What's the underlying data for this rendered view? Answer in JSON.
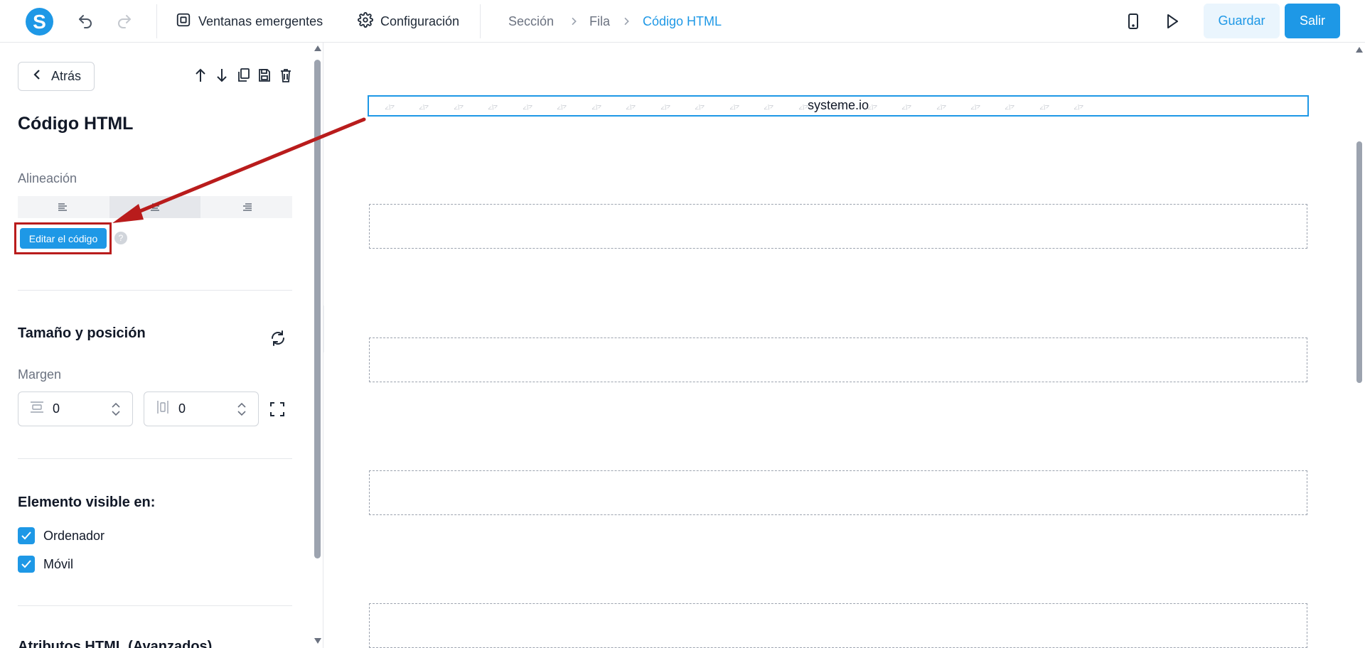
{
  "topbar": {
    "logo_letter": "S",
    "popups_label": "Ventanas emergentes",
    "settings_label": "Configuración",
    "breadcrumb": [
      "Sección",
      "Fila",
      "Código HTML"
    ],
    "save_label": "Guardar",
    "exit_label": "Salir"
  },
  "sidebar": {
    "back_label": "Atrás",
    "title": "Código HTML",
    "alignment_label": "Alineación",
    "edit_code_label": "Editar el código",
    "help_glyph": "?",
    "size_section_title": "Tamaño y posición",
    "margin_label": "Margen",
    "margin_horizontal_value": "0",
    "margin_vertical_value": "0",
    "visibility_title": "Elemento visible en:",
    "visibility_options": [
      {
        "label": "Ordenador",
        "checked": true
      },
      {
        "label": "Móvil",
        "checked": true
      }
    ],
    "advanced_title": "Atributos HTML (Avanzados)"
  },
  "canvas": {
    "html_element_text": "systeme.io"
  },
  "colors": {
    "accent": "#1e98e6",
    "annotation_red": "#b91c1c"
  }
}
